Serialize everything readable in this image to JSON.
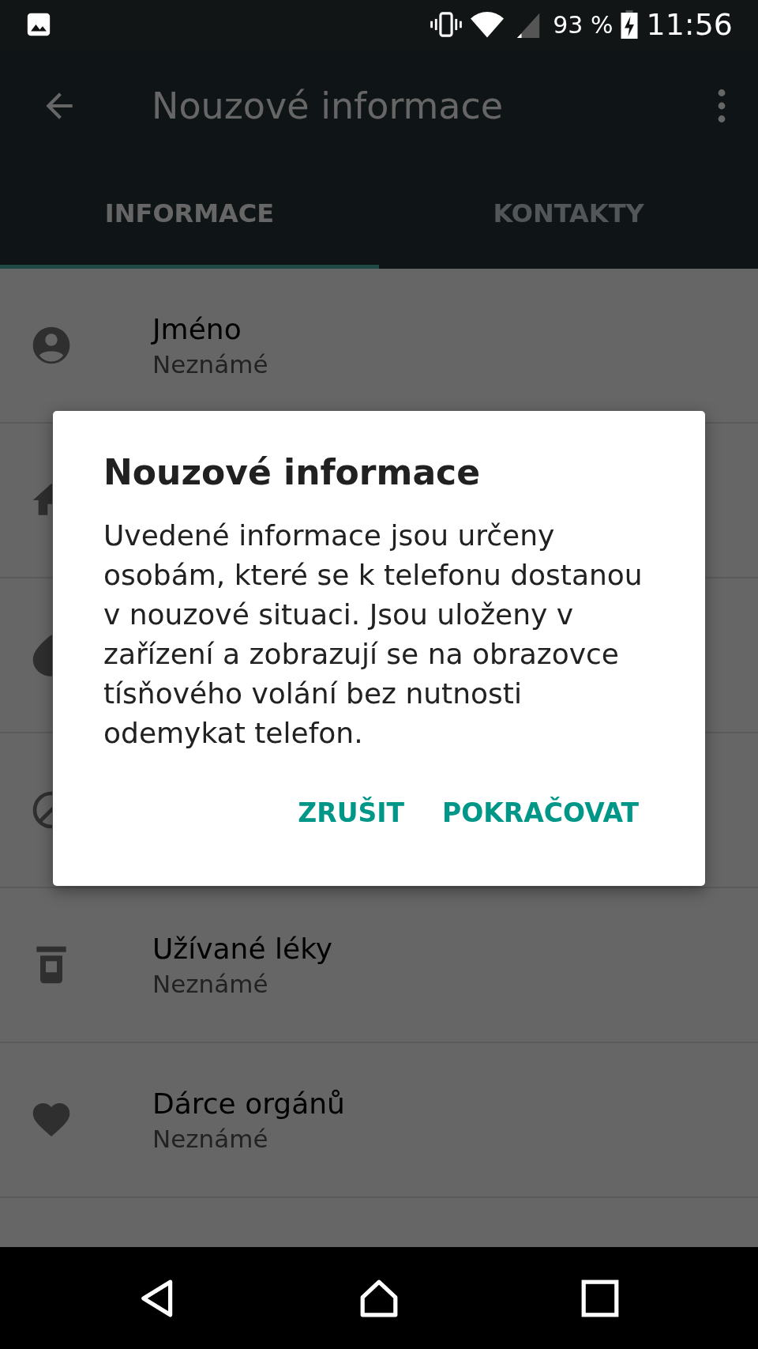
{
  "status_bar": {
    "battery": "93 %",
    "time": "11:56"
  },
  "app_bar": {
    "title": "Nouzové informace"
  },
  "tabs": [
    {
      "label": "INFORMACE",
      "selected": true
    },
    {
      "label": "KONTAKTY",
      "selected": false
    }
  ],
  "rows": [
    {
      "kind": "person",
      "title": "Jméno",
      "value": "Neznámé"
    },
    {
      "kind": "home"
    },
    {
      "kind": "drop"
    },
    {
      "kind": "block"
    },
    {
      "kind": "medicine",
      "title": "Užívané léky",
      "value": "Neznámé"
    },
    {
      "kind": "heart",
      "title": "Dárce orgánů",
      "value": "Neznámé"
    }
  ],
  "dialog": {
    "title": "Nouzové informace",
    "body": "Uvedené informace jsou určeny osobám, které se k telefonu dostanou v nouzové situaci. Jsou uloženy v zařízení a zobrazují se na obrazovce tísňového volání bez nutnosti odemykat telefon.",
    "buttons": [
      "ZRUŠIT",
      "POKRAČOVAT"
    ]
  }
}
